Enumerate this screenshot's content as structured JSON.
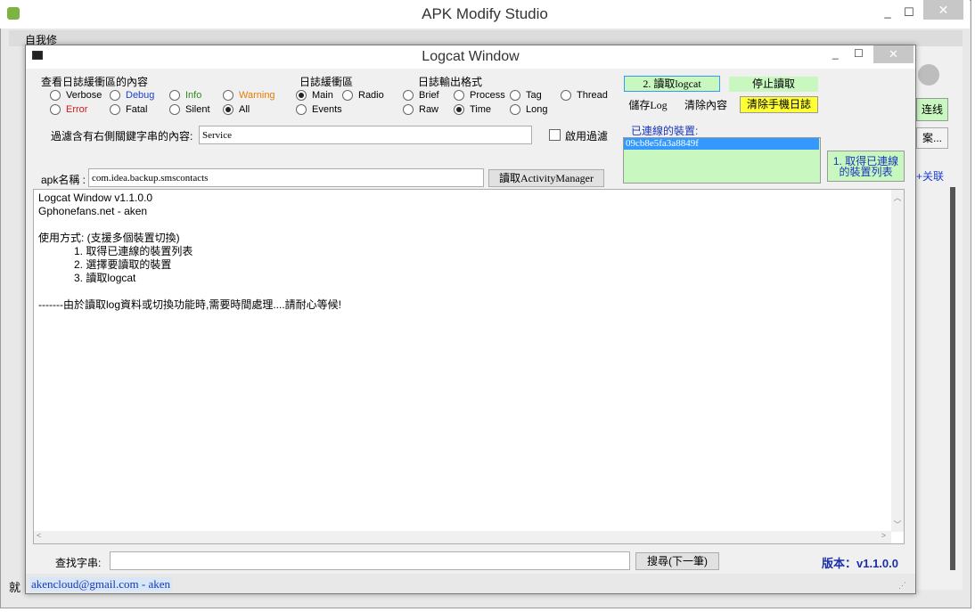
{
  "outer": {
    "title": "APK Modify Studio",
    "min": "_",
    "max": "☐",
    "close": "✕",
    "menu_text": "自我修",
    "right_panel": {
      "connect": "连线",
      "btn2": "案...",
      "link": "+关联"
    },
    "status_char": "就"
  },
  "inner": {
    "title": "Logcat Window",
    "min": "_",
    "max": "☐",
    "close": "✕",
    "buffer_content": {
      "title": "查看日誌緩衝區的內容",
      "options": [
        {
          "label": "Verbose",
          "color": "#000000",
          "selected": false
        },
        {
          "label": "Debug",
          "color": "#1e3fd0",
          "selected": false
        },
        {
          "label": "Info",
          "color": "#2e8b1e",
          "selected": false
        },
        {
          "label": "Warning",
          "color": "#e87c00",
          "selected": false
        },
        {
          "label": "Error",
          "color": "#d01818",
          "selected": false
        },
        {
          "label": "Fatal",
          "color": "#000000",
          "selected": false
        },
        {
          "label": "Silent",
          "color": "#000000",
          "selected": false
        },
        {
          "label": "All",
          "color": "#000000",
          "selected": true
        }
      ]
    },
    "buffer": {
      "title": "日誌緩衝區",
      "options": [
        {
          "label": "Main",
          "selected": true
        },
        {
          "label": "Radio",
          "selected": false
        },
        {
          "label": "Events",
          "selected": false
        }
      ]
    },
    "format": {
      "title": "日誌輸出格式",
      "options": [
        {
          "label": "Brief",
          "selected": false
        },
        {
          "label": "Process",
          "selected": false
        },
        {
          "label": "Tag",
          "selected": false
        },
        {
          "label": "Thread",
          "selected": false
        },
        {
          "label": "Raw",
          "selected": false
        },
        {
          "label": "Time",
          "selected": true
        },
        {
          "label": "Long",
          "selected": false
        }
      ]
    },
    "filter": {
      "label": "過濾含有右側關鍵字串的內容:",
      "value": "Service",
      "enable_label": "啟用過濾",
      "enabled": false
    },
    "apk": {
      "label": "apk名稱 :",
      "value": "com.idea.backup.smscontacts",
      "button": "讀取ActivityManager"
    },
    "buttons": {
      "read_logcat": "2. 讀取logcat",
      "stop_read": "停止讀取",
      "save_log": "儲存Log",
      "clear_content": "清除內容",
      "clear_phone_log": "清除手機日誌",
      "get_devices": "1. 取得已連線\n的裝置列表"
    },
    "devices": {
      "label": "已連線的裝置:",
      "items": [
        "09cb8e5fa3a8849f"
      ]
    },
    "log_lines": [
      "Logcat Window v1.1.0.0",
      "Gphonefans.net - aken",
      "",
      "使用方式: (支援多個裝置切換)",
      "            1. 取得已連線的裝置列表",
      "            2. 選擇要讀取的裝置",
      "            3. 讀取logcat",
      "",
      "-------由於讀取log資料或切換功能時,需要時間處理....請耐心等候!"
    ],
    "search": {
      "label": "查找字串:",
      "value": "",
      "button": "搜尋(下一筆)"
    },
    "version": "版本：v1.1.0.0",
    "status_email": "akencloud@gmail.com - aken"
  }
}
